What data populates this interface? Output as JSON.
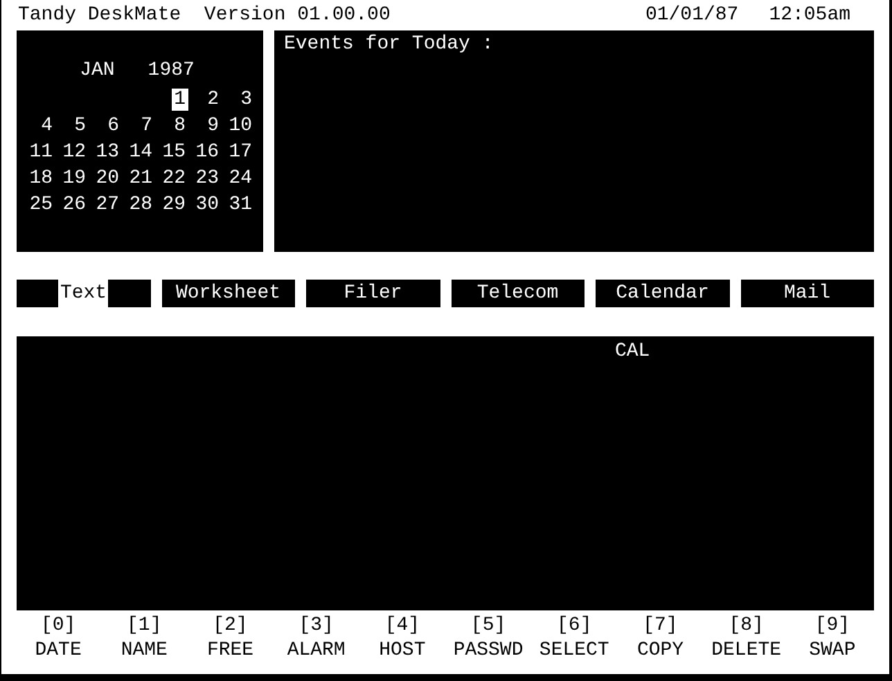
{
  "header": {
    "title": "Tandy DeskMate  Version 01.00.00",
    "date": "01/01/87",
    "time": "12:05am"
  },
  "calendar": {
    "month": "JAN",
    "year": "1987",
    "weeks": [
      {
        "days": [
          {
            "label": "1",
            "selected": true
          },
          {
            "label": "2",
            "selected": false
          },
          {
            "label": "3",
            "selected": false
          }
        ]
      },
      {
        "days": [
          {
            "label": "4",
            "selected": false
          },
          {
            "label": "5",
            "selected": false
          },
          {
            "label": "6",
            "selected": false
          },
          {
            "label": "7",
            "selected": false
          },
          {
            "label": "8",
            "selected": false
          },
          {
            "label": "9",
            "selected": false
          },
          {
            "label": "10",
            "selected": false
          }
        ]
      },
      {
        "days": [
          {
            "label": "11",
            "selected": false
          },
          {
            "label": "12",
            "selected": false
          },
          {
            "label": "13",
            "selected": false
          },
          {
            "label": "14",
            "selected": false
          },
          {
            "label": "15",
            "selected": false
          },
          {
            "label": "16",
            "selected": false
          },
          {
            "label": "17",
            "selected": false
          }
        ]
      },
      {
        "days": [
          {
            "label": "18",
            "selected": false
          },
          {
            "label": "19",
            "selected": false
          },
          {
            "label": "20",
            "selected": false
          },
          {
            "label": "21",
            "selected": false
          },
          {
            "label": "22",
            "selected": false
          },
          {
            "label": "23",
            "selected": false
          },
          {
            "label": "24",
            "selected": false
          }
        ]
      },
      {
        "days": [
          {
            "label": "25",
            "selected": false
          },
          {
            "label": "26",
            "selected": false
          },
          {
            "label": "27",
            "selected": false
          },
          {
            "label": "28",
            "selected": false
          },
          {
            "label": "29",
            "selected": false
          },
          {
            "label": "30",
            "selected": false
          },
          {
            "label": "31",
            "selected": false
          }
        ]
      }
    ]
  },
  "events": {
    "heading": "Events for Today :"
  },
  "tabs": [
    {
      "label": "Text",
      "selected": true
    },
    {
      "label": "Worksheet",
      "selected": false
    },
    {
      "label": "Filer",
      "selected": false
    },
    {
      "label": "Telecom",
      "selected": false
    },
    {
      "label": "Calendar",
      "selected": false
    },
    {
      "label": "Mail",
      "selected": false
    }
  ],
  "file_panel": {
    "files": [
      "CAL"
    ]
  },
  "function_keys": [
    {
      "key": "[0]",
      "label": "DATE"
    },
    {
      "key": "[1]",
      "label": "NAME"
    },
    {
      "key": "[2]",
      "label": "FREE"
    },
    {
      "key": "[3]",
      "label": "ALARM"
    },
    {
      "key": "[4]",
      "label": "HOST"
    },
    {
      "key": "[5]",
      "label": "PASSWD"
    },
    {
      "key": "[6]",
      "label": "SELECT"
    },
    {
      "key": "[7]",
      "label": "COPY"
    },
    {
      "key": "[8]",
      "label": "DELETE"
    },
    {
      "key": "[9]",
      "label": "SWAP"
    }
  ]
}
